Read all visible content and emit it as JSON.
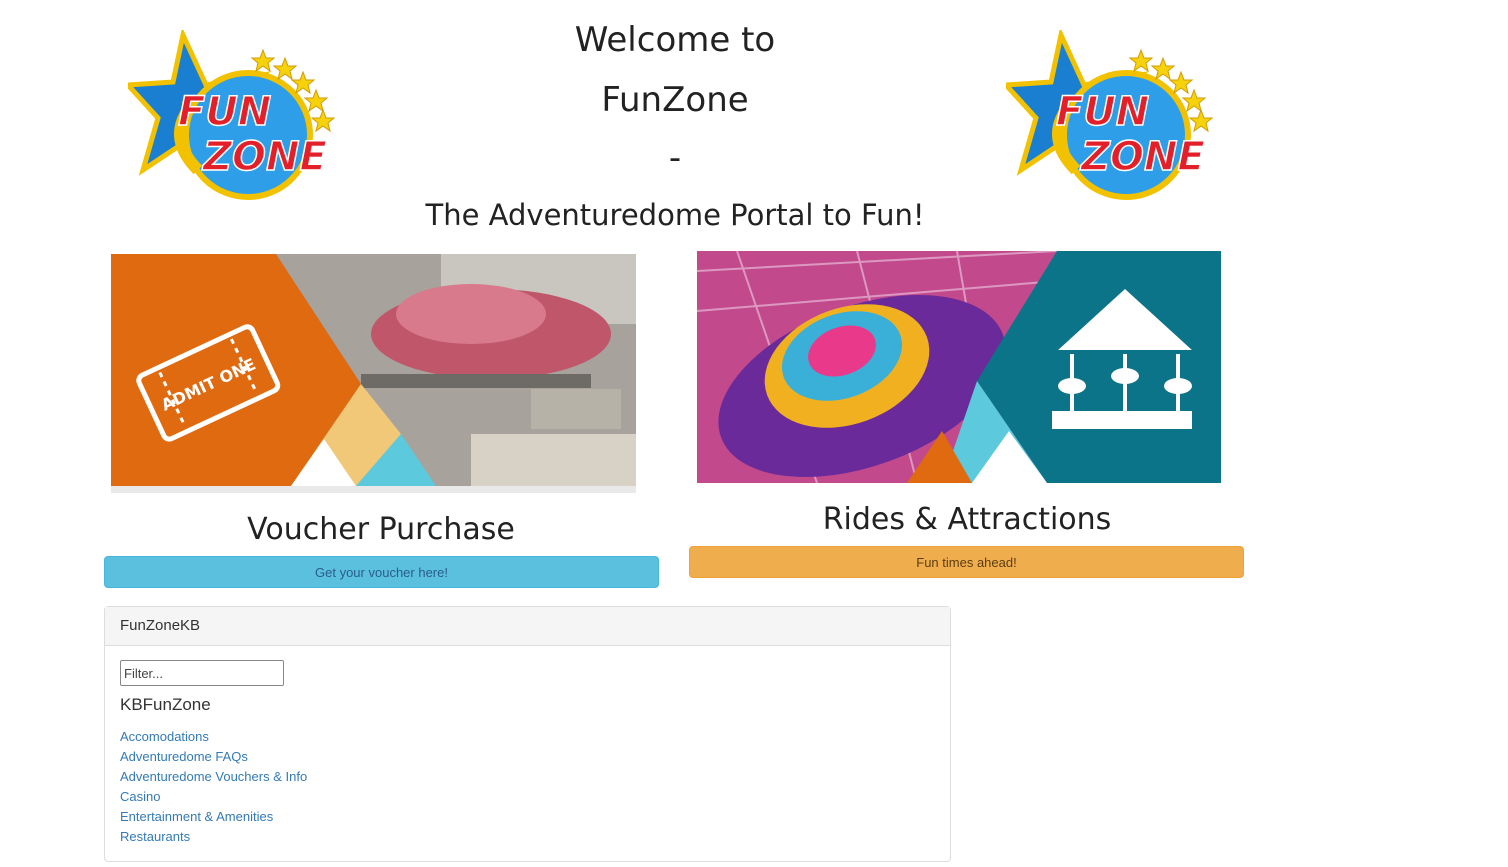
{
  "header": {
    "welcome_line1": "Welcome to",
    "welcome_line2": "FunZone",
    "dash": "-",
    "tagline": "The Adventuredome Portal to Fun!",
    "logo_text_top": "FUN",
    "logo_text_bottom": "ZONE"
  },
  "cards": {
    "voucher": {
      "image_text": "ADMIT ONE",
      "title": "Voucher Purchase",
      "button_label": "Get your voucher here!"
    },
    "rides": {
      "title": "Rides & Attractions",
      "button_label": "Fun times ahead!"
    }
  },
  "kb_panel": {
    "header": "FunZoneKB",
    "filter_placeholder": "Filter...",
    "heading": "KBFunZone",
    "links": [
      "Accomodations",
      "Adventuredome FAQs",
      "Adventuredome Vouchers & Info",
      "Casino",
      "Entertainment & Amenities",
      "Restaurants"
    ]
  },
  "colors": {
    "voucher_orange": "#e06a10",
    "rides_teal": "#0c7489",
    "accent_light_blue": "#5bc0de",
    "accent_yellow": "#f0ad4e",
    "link_blue": "#337ab7"
  }
}
